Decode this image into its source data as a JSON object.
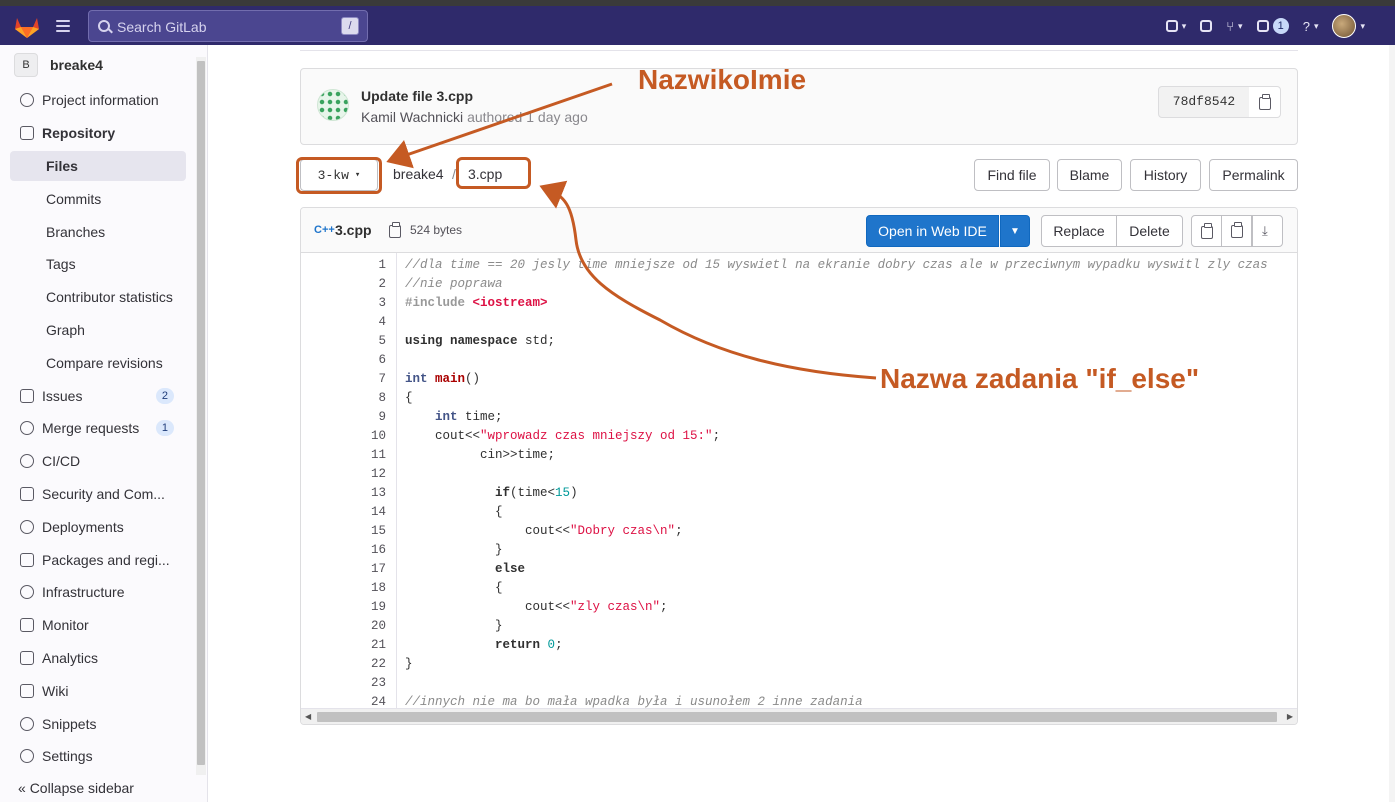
{
  "topbar": {
    "search_placeholder": "Search GitLab",
    "search_shortcut": "/",
    "todo_count": "1"
  },
  "sidebar": {
    "project_initial": "B",
    "project_name": "breake4",
    "items": [
      {
        "label": "Project information",
        "icon": "info-icon"
      },
      {
        "label": "Repository",
        "icon": "book-icon"
      },
      {
        "label": "Files"
      },
      {
        "label": "Commits"
      },
      {
        "label": "Branches"
      },
      {
        "label": "Tags"
      },
      {
        "label": "Contributor statistics"
      },
      {
        "label": "Graph"
      },
      {
        "label": "Compare revisions"
      },
      {
        "label": "Issues",
        "icon": "issues-icon",
        "count": "2"
      },
      {
        "label": "Merge requests",
        "icon": "merge-request-icon",
        "count": "1"
      },
      {
        "label": "CI/CD",
        "icon": "rocket-icon"
      },
      {
        "label": "Security and Com...",
        "icon": "shield-icon"
      },
      {
        "label": "Deployments",
        "icon": "deployments-icon"
      },
      {
        "label": "Packages and regi...",
        "icon": "package-icon"
      },
      {
        "label": "Infrastructure",
        "icon": "cloud-icon"
      },
      {
        "label": "Monitor",
        "icon": "monitor-icon"
      },
      {
        "label": "Analytics",
        "icon": "chart-icon"
      },
      {
        "label": "Wiki",
        "icon": "book-icon"
      },
      {
        "label": "Snippets",
        "icon": "snippet-icon"
      },
      {
        "label": "Settings",
        "icon": "gear-icon"
      }
    ],
    "collapse_label": "Collapse sidebar"
  },
  "commit": {
    "title": "Update file 3.cpp",
    "author": "Kamil Wachnicki",
    "authored": "authored",
    "time": "1 day ago",
    "sha": "78df8542"
  },
  "nav": {
    "branch": "3-kw",
    "breadcrumb_project": "breake4",
    "breadcrumb_sep": "/",
    "breadcrumb_file": "3.cpp",
    "buttons": {
      "find_file": "Find file",
      "blame": "Blame",
      "history": "History",
      "permalink": "Permalink"
    }
  },
  "file": {
    "name": "3.cpp",
    "size": "524 bytes",
    "open_ide": "Open in Web IDE",
    "replace": "Replace",
    "delete": "Delete"
  },
  "code_lines": [
    "//dla time == 20 jesly time mniejsze od 15 wyswietl na ekranie dobry czas ale w przeciwnym wypadku wyswitl zly czas",
    "//nie poprawa",
    "#include <iostream>",
    "",
    "using namespace std;",
    "",
    "int main()",
    "{",
    "    int time;",
    "    cout<<\"wprowadz czas mniejszy od 15:\";",
    "          cin>>time;",
    "",
    "            if(time<15)",
    "            {",
    "                cout<<\"Dobry czas\\n\";",
    "            }",
    "            else",
    "            {",
    "                cout<<\"zly czas\\n\";",
    "            }",
    "            return 0;",
    "}",
    "",
    "//innych nie ma bo mała wpadka była i usunołem 2 inne zadania"
  ],
  "annotations": {
    "name_label": "NazwikoImie",
    "task_label": "Nazwa zadania \"if_else\""
  },
  "colors": {
    "topbar": "#2f2a6b",
    "primary": "#1f75cb",
    "annotation": "#c55a23"
  }
}
